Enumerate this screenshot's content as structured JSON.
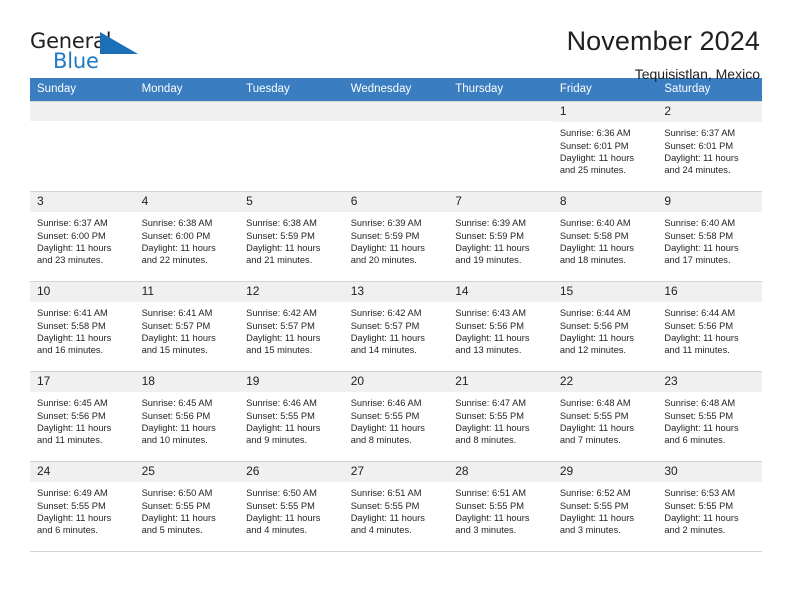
{
  "brand": {
    "word_one": "General",
    "word_two": "Blue",
    "flag_icon": "triangle-flag-icon"
  },
  "header": {
    "title": "November 2024",
    "subtitle": "Tequisistlan, Mexico"
  },
  "colors": {
    "header_row": "#3a7ec1",
    "day_number_bg": "#f0f0f0",
    "brand_blue": "#1f7ac4",
    "text": "#231f20",
    "grid_line": "#d4d4d4"
  },
  "weekdays": [
    "Sunday",
    "Monday",
    "Tuesday",
    "Wednesday",
    "Thursday",
    "Friday",
    "Saturday"
  ],
  "labels": {
    "sunrise": "Sunrise:",
    "sunset": "Sunset:",
    "daylight": "Daylight:"
  },
  "weeks": [
    [
      {
        "day": "",
        "empty": true
      },
      {
        "day": "",
        "empty": true
      },
      {
        "day": "",
        "empty": true
      },
      {
        "day": "",
        "empty": true
      },
      {
        "day": "",
        "empty": true
      },
      {
        "day": "1",
        "sunrise": "Sunrise: 6:36 AM",
        "sunset": "Sunset: 6:01 PM",
        "daylight": "Daylight: 11 hours and 25 minutes."
      },
      {
        "day": "2",
        "sunrise": "Sunrise: 6:37 AM",
        "sunset": "Sunset: 6:01 PM",
        "daylight": "Daylight: 11 hours and 24 minutes."
      }
    ],
    [
      {
        "day": "3",
        "sunrise": "Sunrise: 6:37 AM",
        "sunset": "Sunset: 6:00 PM",
        "daylight": "Daylight: 11 hours and 23 minutes."
      },
      {
        "day": "4",
        "sunrise": "Sunrise: 6:38 AM",
        "sunset": "Sunset: 6:00 PM",
        "daylight": "Daylight: 11 hours and 22 minutes."
      },
      {
        "day": "5",
        "sunrise": "Sunrise: 6:38 AM",
        "sunset": "Sunset: 5:59 PM",
        "daylight": "Daylight: 11 hours and 21 minutes."
      },
      {
        "day": "6",
        "sunrise": "Sunrise: 6:39 AM",
        "sunset": "Sunset: 5:59 PM",
        "daylight": "Daylight: 11 hours and 20 minutes."
      },
      {
        "day": "7",
        "sunrise": "Sunrise: 6:39 AM",
        "sunset": "Sunset: 5:59 PM",
        "daylight": "Daylight: 11 hours and 19 minutes."
      },
      {
        "day": "8",
        "sunrise": "Sunrise: 6:40 AM",
        "sunset": "Sunset: 5:58 PM",
        "daylight": "Daylight: 11 hours and 18 minutes."
      },
      {
        "day": "9",
        "sunrise": "Sunrise: 6:40 AM",
        "sunset": "Sunset: 5:58 PM",
        "daylight": "Daylight: 11 hours and 17 minutes."
      }
    ],
    [
      {
        "day": "10",
        "sunrise": "Sunrise: 6:41 AM",
        "sunset": "Sunset: 5:58 PM",
        "daylight": "Daylight: 11 hours and 16 minutes."
      },
      {
        "day": "11",
        "sunrise": "Sunrise: 6:41 AM",
        "sunset": "Sunset: 5:57 PM",
        "daylight": "Daylight: 11 hours and 15 minutes."
      },
      {
        "day": "12",
        "sunrise": "Sunrise: 6:42 AM",
        "sunset": "Sunset: 5:57 PM",
        "daylight": "Daylight: 11 hours and 15 minutes."
      },
      {
        "day": "13",
        "sunrise": "Sunrise: 6:42 AM",
        "sunset": "Sunset: 5:57 PM",
        "daylight": "Daylight: 11 hours and 14 minutes."
      },
      {
        "day": "14",
        "sunrise": "Sunrise: 6:43 AM",
        "sunset": "Sunset: 5:56 PM",
        "daylight": "Daylight: 11 hours and 13 minutes."
      },
      {
        "day": "15",
        "sunrise": "Sunrise: 6:44 AM",
        "sunset": "Sunset: 5:56 PM",
        "daylight": "Daylight: 11 hours and 12 minutes."
      },
      {
        "day": "16",
        "sunrise": "Sunrise: 6:44 AM",
        "sunset": "Sunset: 5:56 PM",
        "daylight": "Daylight: 11 hours and 11 minutes."
      }
    ],
    [
      {
        "day": "17",
        "sunrise": "Sunrise: 6:45 AM",
        "sunset": "Sunset: 5:56 PM",
        "daylight": "Daylight: 11 hours and 11 minutes."
      },
      {
        "day": "18",
        "sunrise": "Sunrise: 6:45 AM",
        "sunset": "Sunset: 5:56 PM",
        "daylight": "Daylight: 11 hours and 10 minutes."
      },
      {
        "day": "19",
        "sunrise": "Sunrise: 6:46 AM",
        "sunset": "Sunset: 5:55 PM",
        "daylight": "Daylight: 11 hours and 9 minutes."
      },
      {
        "day": "20",
        "sunrise": "Sunrise: 6:46 AM",
        "sunset": "Sunset: 5:55 PM",
        "daylight": "Daylight: 11 hours and 8 minutes."
      },
      {
        "day": "21",
        "sunrise": "Sunrise: 6:47 AM",
        "sunset": "Sunset: 5:55 PM",
        "daylight": "Daylight: 11 hours and 8 minutes."
      },
      {
        "day": "22",
        "sunrise": "Sunrise: 6:48 AM",
        "sunset": "Sunset: 5:55 PM",
        "daylight": "Daylight: 11 hours and 7 minutes."
      },
      {
        "day": "23",
        "sunrise": "Sunrise: 6:48 AM",
        "sunset": "Sunset: 5:55 PM",
        "daylight": "Daylight: 11 hours and 6 minutes."
      }
    ],
    [
      {
        "day": "24",
        "sunrise": "Sunrise: 6:49 AM",
        "sunset": "Sunset: 5:55 PM",
        "daylight": "Daylight: 11 hours and 6 minutes."
      },
      {
        "day": "25",
        "sunrise": "Sunrise: 6:50 AM",
        "sunset": "Sunset: 5:55 PM",
        "daylight": "Daylight: 11 hours and 5 minutes."
      },
      {
        "day": "26",
        "sunrise": "Sunrise: 6:50 AM",
        "sunset": "Sunset: 5:55 PM",
        "daylight": "Daylight: 11 hours and 4 minutes."
      },
      {
        "day": "27",
        "sunrise": "Sunrise: 6:51 AM",
        "sunset": "Sunset: 5:55 PM",
        "daylight": "Daylight: 11 hours and 4 minutes."
      },
      {
        "day": "28",
        "sunrise": "Sunrise: 6:51 AM",
        "sunset": "Sunset: 5:55 PM",
        "daylight": "Daylight: 11 hours and 3 minutes."
      },
      {
        "day": "29",
        "sunrise": "Sunrise: 6:52 AM",
        "sunset": "Sunset: 5:55 PM",
        "daylight": "Daylight: 11 hours and 3 minutes."
      },
      {
        "day": "30",
        "sunrise": "Sunrise: 6:53 AM",
        "sunset": "Sunset: 5:55 PM",
        "daylight": "Daylight: 11 hours and 2 minutes."
      }
    ]
  ]
}
